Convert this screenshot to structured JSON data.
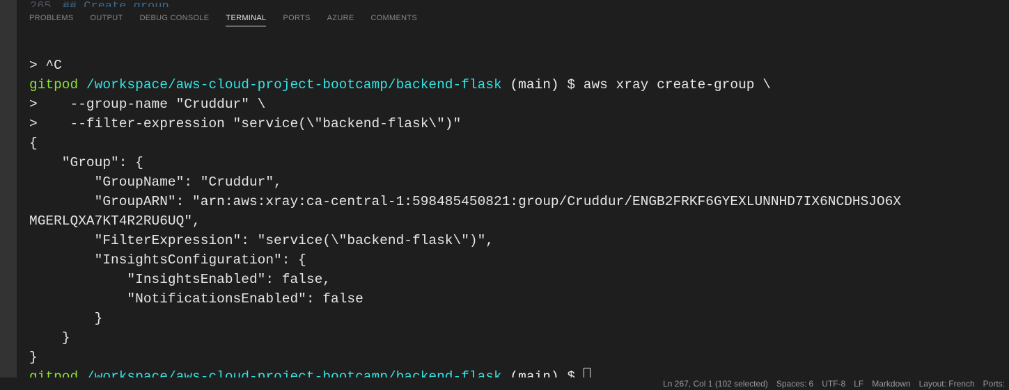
{
  "editor_hint": {
    "line": "265",
    "text": "## Create group"
  },
  "tabs": {
    "problems": "PROBLEMS",
    "output": "OUTPUT",
    "debug": "DEBUG CONSOLE",
    "terminal": "TERMINAL",
    "ports": "PORTS",
    "azure": "AZURE",
    "comments": "COMMENTS"
  },
  "terminal": {
    "line1_prompt": "> ",
    "line1_text": "^C",
    "prompt_user": "gitpod",
    "prompt_path": " /workspace/aws-cloud-project-bootcamp/backend-flask",
    "prompt_branch": " (main) ",
    "prompt_symbol": "$ ",
    "cmd1": "aws xray create-group \\",
    "cont_prefix": ">    ",
    "cmd2": "--group-name \"Cruddur\" \\",
    "cmd3": "--filter-expression \"service(\\\"backend-flask\\\")\"",
    "out1": "{",
    "out2": "    \"Group\": {",
    "out3": "        \"GroupName\": \"Cruddur\",",
    "out4": "        \"GroupARN\": \"arn:aws:xray:ca-central-1:598485450821:group/Cruddur/ENGB2FRKF6GYEXLUNNHD7IX6NCDHSJO6X",
    "out4b": "MGERLQXA7KT4R2RU6UQ\",",
    "out5": "        \"FilterExpression\": \"service(\\\"backend-flask\\\")\",",
    "out6": "        \"InsightsConfiguration\": {",
    "out7": "            \"InsightsEnabled\": false,",
    "out8": "            \"NotificationsEnabled\": false",
    "out9": "        }",
    "out10": "    }",
    "out11": "}"
  },
  "status": {
    "pos": "Ln 267, Col 1 (102 selected)",
    "spaces": "Spaces: 6",
    "encoding": "UTF-8",
    "eol": "LF",
    "lang": "Markdown",
    "layout": "Layout: French",
    "ports": "Ports:"
  }
}
